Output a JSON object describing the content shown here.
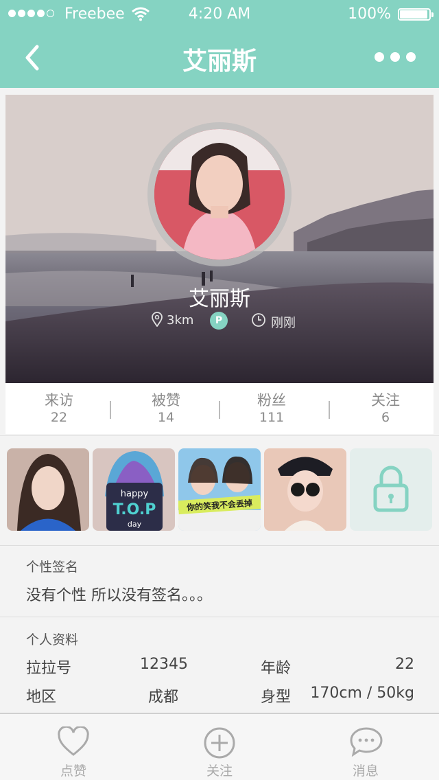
{
  "status_bar": {
    "carrier": "Freebee",
    "time": "4:20 AM",
    "battery": "100%"
  },
  "nav": {
    "title": "艾丽斯",
    "back_icon": "chevron-left-icon",
    "more_icon": "more-horizontal-icon"
  },
  "profile": {
    "name": "艾丽斯",
    "distance": "3km",
    "badge": "P",
    "last_active": "刚刚"
  },
  "stats": [
    {
      "label": "来访",
      "value": "22"
    },
    {
      "label": "被赞",
      "value": "14"
    },
    {
      "label": "粉丝",
      "value": "111"
    },
    {
      "label": "关注",
      "value": "6"
    }
  ],
  "photos": {
    "count": 4,
    "locked_icon": "padlock-icon"
  },
  "signature": {
    "heading": "个性签名",
    "text": "没有个性 所以没有签名。。。"
  },
  "details": {
    "heading": "个人资料",
    "rows": [
      {
        "k1": "拉拉号",
        "v1": "12345",
        "k2": "年龄",
        "v2": "22"
      },
      {
        "k1": "地区",
        "v1": "成都",
        "k2": "身型",
        "v2": "170cm / 50kg"
      }
    ]
  },
  "tabbar": [
    {
      "label": "点赞",
      "icon": "heart-icon"
    },
    {
      "label": "关注",
      "icon": "plus-circle-icon"
    },
    {
      "label": "消息",
      "icon": "chat-bubble-icon"
    }
  ],
  "colors": {
    "accent": "#85d3c2"
  }
}
